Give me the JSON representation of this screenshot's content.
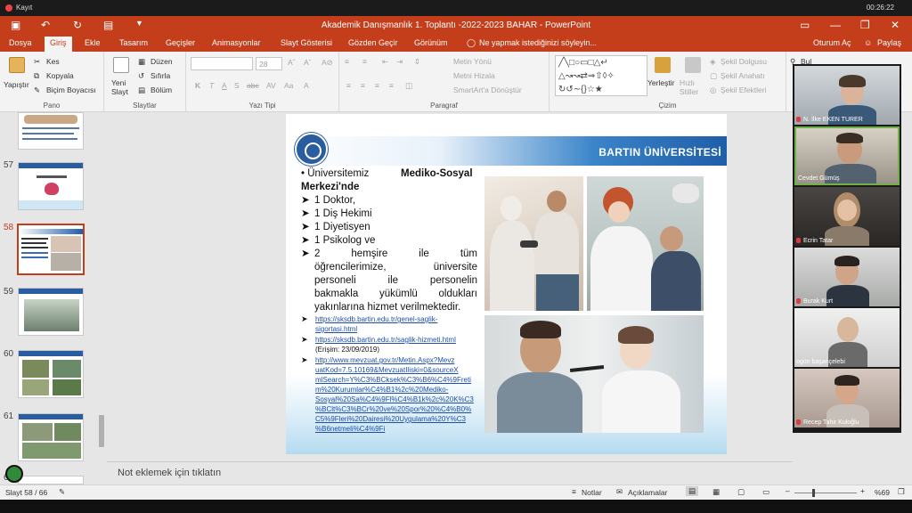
{
  "recording": {
    "label": "Kayıt",
    "time": "00:26:22"
  },
  "window": {
    "title": "Akademik Danışmanlık 1. Toplantı -2022-2023 BAHAR - PowerPoint"
  },
  "tabs": [
    "Dosya",
    "Giriş",
    "Ekle",
    "Tasarım",
    "Geçişler",
    "Animasyonlar",
    "Slayt Gösterisi",
    "Gözden Geçir",
    "Görünüm"
  ],
  "active_tab": "Giriş",
  "tell_me": "Ne yapmak istediğinizi söyleyin...",
  "sign_in": "Oturum Aç",
  "share": "Paylaş",
  "ribbon": {
    "clipboard": {
      "paste": "Yapıştır",
      "cut": "Kes",
      "copy": "Kopyala",
      "format_painter": "Biçim Boyacısı",
      "label": "Pano"
    },
    "slides": {
      "new_slide": "Yeni Slayt",
      "layout": "Düzen",
      "reset": "Sıfırla",
      "section": "Bölüm",
      "label": "Slaytlar"
    },
    "font": {
      "size": "28",
      "label": "Yazı Tipi"
    },
    "paragraph": {
      "text_direction": "Metin Yönü",
      "align_text": "Metni Hizala",
      "smartart": "SmartArt'a Dönüştür",
      "label": "Paragraf"
    },
    "drawing": {
      "arrange": "Yerleştir",
      "quick_styles": "Hızlı Stiller",
      "fill": "Şekil Dolgusu",
      "outline": "Şekil Anahatı",
      "effects": "Şekil Efektleri",
      "label": "Çizim"
    },
    "editing": {
      "find": "Bul"
    }
  },
  "thumbnails": [
    {
      "num": "57"
    },
    {
      "num": "58"
    },
    {
      "num": "59"
    },
    {
      "num": "60"
    },
    {
      "num": "61"
    },
    {
      "num": "62"
    }
  ],
  "slide": {
    "university": "BARTIN ÜNİVERSİTESİ",
    "intro_line1": "• Üniversitemiz",
    "intro_line1b": "Mediko-Sosyal",
    "intro_line2": "Merkezi'nde",
    "items": [
      "1 Doktor,",
      "1 Diş Hekimi",
      "1 Diyetisyen",
      "1 Psikolog ve"
    ],
    "para_lines": [
      "2 hemşire ile tüm",
      "öğrencilerimize, üniversite",
      "personeli ile personelin",
      "bakmakla yükümlü oldukları",
      "yakınlarına hizmet verilmektedir."
    ],
    "link1_a": "https://sksdb.bartin.edu.tr/genel-saglik-",
    "link1_b": "sigortasi.html",
    "link2": "https://sksdb.bartin.edu.tr/saglik-hizmeti.html",
    "access": "(Erişim: 23/09/2019)",
    "link3": [
      "http://www.mevzuat.gov.tr/Metin.Aspx?Mevz",
      "uatKod=7.5.10169&MevzuatIliski=0&sourceX",
      "mlSearch=Y%C3%BCksek%C3%B6%C4%9Freti",
      "m%20Kurumlar%C4%B1%2c%20Mediko-",
      "Sosyal%20Sa%C4%9Fl%C4%B1k%2c%20K%C3",
      "%BClt%C3%BCr%20ve%20Spor%20%C4%B0%",
      "C5%9Fleri%20Dairesi%20Uygulama%20Y%C3",
      "%B6netmeli%C4%9Fi"
    ]
  },
  "notes_placeholder": "Not eklemek için tıklatın",
  "status": {
    "slide": "Slayt 58 / 66",
    "notes": "Notlar",
    "comments": "Açıklamalar",
    "zoom": "%69"
  },
  "participants": [
    {
      "name": "N. İlke EKEN TURER"
    },
    {
      "name": "Cevdet Gümüş"
    },
    {
      "name": "Ecrin Tatar"
    },
    {
      "name": "Burak Kurt"
    },
    {
      "name": "ogün başançelebi"
    },
    {
      "name": "Recep Tahir Kuloğlu"
    }
  ]
}
